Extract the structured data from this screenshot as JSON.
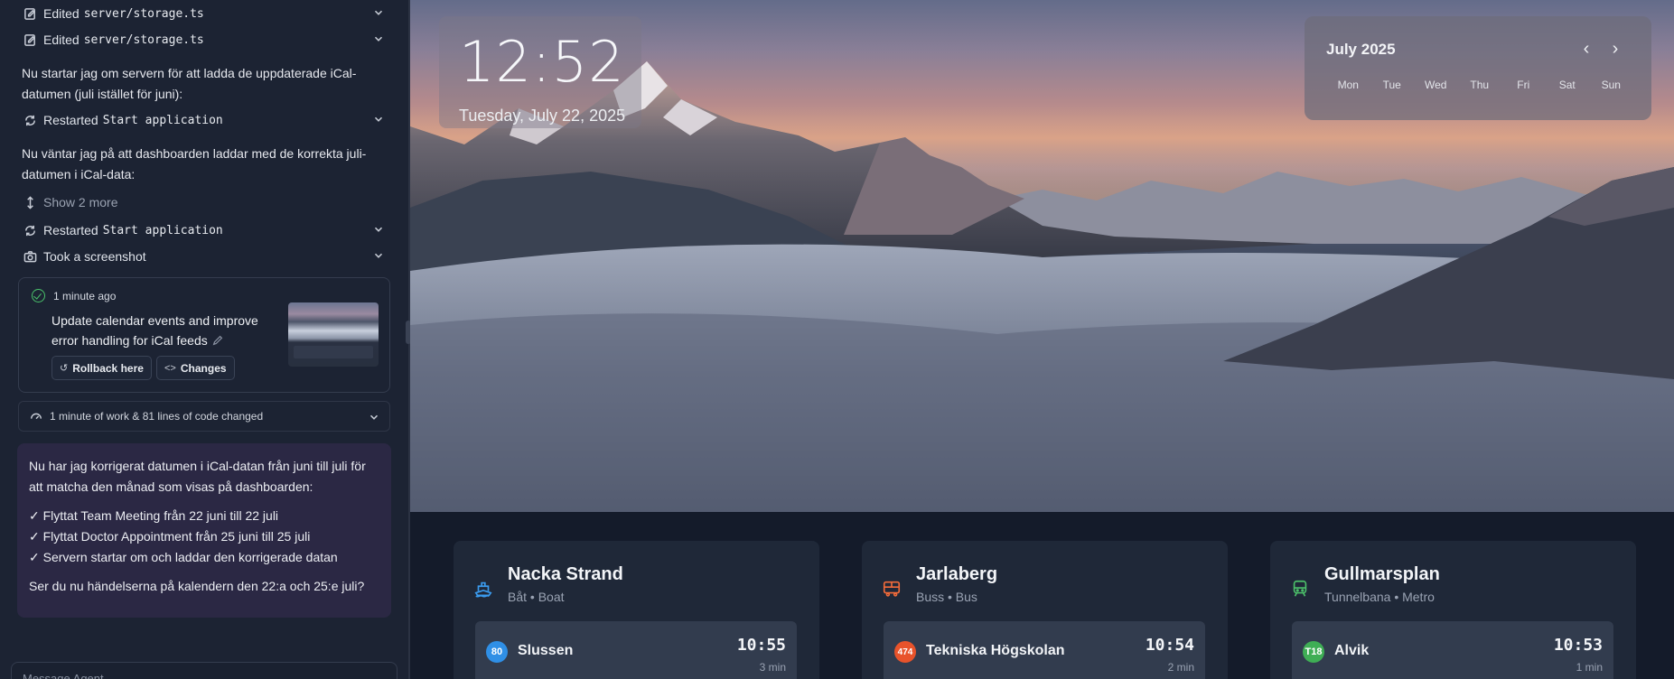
{
  "agent_panel": {
    "actions_top": [
      {
        "label": "Edited",
        "code": "server/storage.ts"
      },
      {
        "label": "Edited",
        "code": "server/storage.ts"
      }
    ],
    "para1": "Nu startar jag om servern för att ladda de uppdaterade iCal-datumen (juli istället för juni):",
    "restart1": {
      "label": "Restarted",
      "code": "Start application"
    },
    "para2": "Nu väntar jag på att dashboarden laddar med de korrekta juli-datumen i iCal-data:",
    "show_more": "Show 2 more",
    "restart2": {
      "label": "Restarted",
      "code": "Start application"
    },
    "screenshot": "Took a screenshot",
    "checkpoint": {
      "time": "1 minute ago",
      "title": "Update calendar events and improve error handling for iCal feeds",
      "rollback": "Rollback here",
      "changes": "Changes"
    },
    "work_summary": "1 minute of work & 81 lines of code changed",
    "message": {
      "intro": "Nu har jag korrigerat datumen i iCal-datan från juni till juli för att matcha den månad som visas på dashboarden:",
      "items": [
        "✓ Flyttat Team Meeting från 22 juni till 22 juli",
        "✓ Flyttat Doctor Appointment från 25 juni till 25 juli",
        "✓ Servern startar om och laddar den korrigerade datan"
      ],
      "question": "Ser du nu händelserna på kalendern den 22:a och 25:e juli?"
    },
    "input_placeholder": "Message Agent..."
  },
  "dashboard": {
    "clock": {
      "time": "12:52",
      "date": "Tuesday, July 22, 2025"
    },
    "calendar": {
      "month": "July 2025",
      "weekdays": [
        "Mon",
        "Tue",
        "Wed",
        "Thu",
        "Fri",
        "Sat",
        "Sun"
      ]
    },
    "stations": [
      {
        "name": "Nacka Strand",
        "type": "Båt • Boat",
        "icon": "boat-icon",
        "color": "#3b9cf0",
        "departure": {
          "line": "80",
          "line_color": "#2f8fe6",
          "destination": "Slussen",
          "time": "10:55",
          "minutes": "3 min"
        }
      },
      {
        "name": "Jarlaberg",
        "type": "Buss • Bus",
        "icon": "bus-icon",
        "color": "#f26b3a",
        "departure": {
          "line": "474",
          "line_color": "#e8532b",
          "destination": "Tekniska Högskolan",
          "time": "10:54",
          "minutes": "2 min"
        }
      },
      {
        "name": "Gullmarsplan",
        "type": "Tunnelbana • Metro",
        "icon": "metro-icon",
        "color": "#4cc06a",
        "departure": {
          "line": "T18",
          "line_color": "#3fae55",
          "destination": "Alvik",
          "time": "10:53",
          "minutes": "1 min"
        }
      }
    ]
  }
}
